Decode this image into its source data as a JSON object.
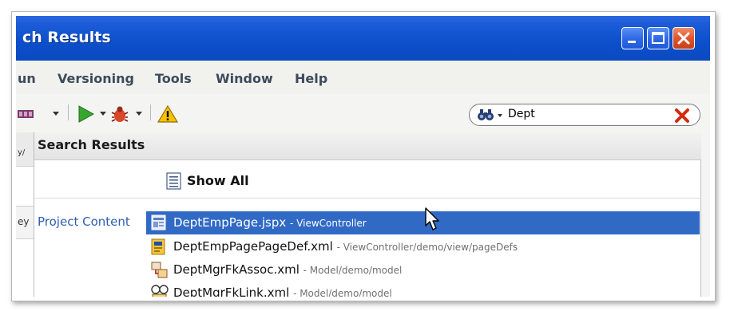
{
  "window": {
    "title": "ch Results"
  },
  "menu": {
    "items": [
      "un",
      "Versioning",
      "Tools",
      "Window",
      "Help"
    ]
  },
  "toolbar": {
    "icons": [
      "vcs-icon",
      "run-icon",
      "debug-icon",
      "warning-icon"
    ]
  },
  "search": {
    "value": "Dept",
    "icon": "binoculars-icon"
  },
  "left_fragments": [
    "y/",
    "ey"
  ],
  "popup": {
    "title": "Search Results",
    "show_all_label": "Show All",
    "section_label": "Project Content",
    "results": [
      {
        "name": "DeptEmpPage.jspx",
        "path": "- ViewController",
        "icon": "jspx-page-icon",
        "selected": true
      },
      {
        "name": "DeptEmpPagePageDef.xml",
        "path": "- ViewController/demo/view/pageDefs",
        "icon": "pagedef-icon",
        "selected": false
      },
      {
        "name": "DeptMgrFkAssoc.xml",
        "path": "- Model/demo/model",
        "icon": "association-icon",
        "selected": false
      },
      {
        "name": "DeptMgrFkLink.xml",
        "path": "- Model/demo/model",
        "icon": "viewlink-icon",
        "selected": false
      }
    ]
  },
  "colors": {
    "titlebar": "#0d4fcb",
    "selection": "#316ac5",
    "section_label": "#2f5fb0",
    "close_button": "#e0542c"
  }
}
